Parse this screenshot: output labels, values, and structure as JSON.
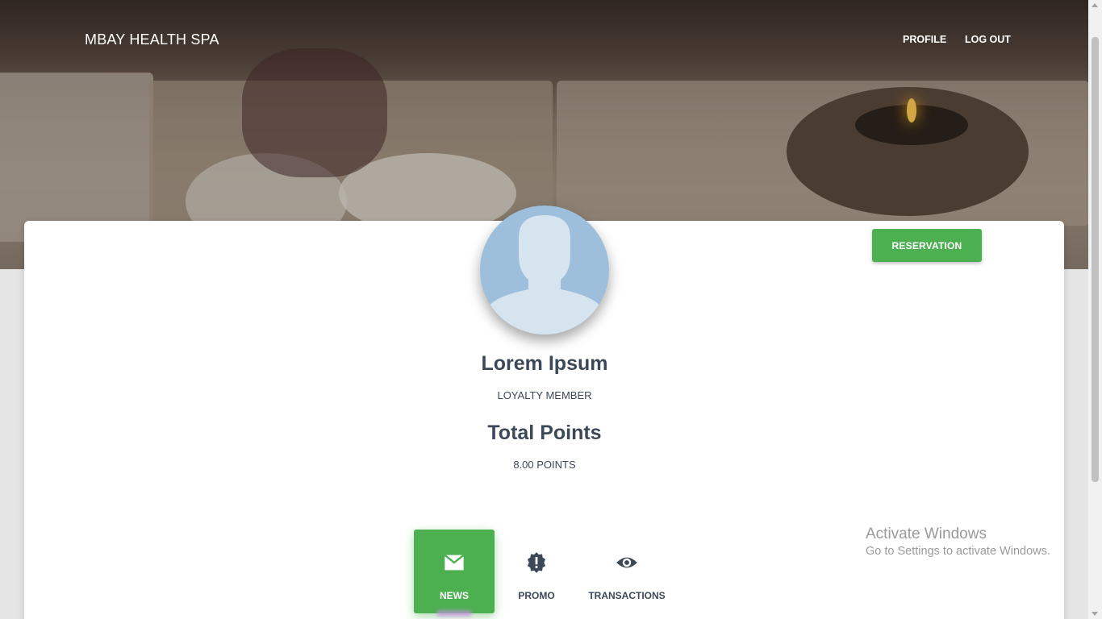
{
  "navbar": {
    "brand": "MBAY HEALTH SPA",
    "links": [
      {
        "label": "PROFILE"
      },
      {
        "label": "LOG OUT"
      }
    ]
  },
  "profile": {
    "name": "Lorem Ipsum",
    "role": "LOYALTY MEMBER",
    "points_title": "Total Points",
    "points_value": "8.00 POINTS",
    "reservation_label": "RESERVATION"
  },
  "tabs": [
    {
      "label": "NEWS",
      "icon": "envelope-icon",
      "active": true
    },
    {
      "label": "PROMO",
      "icon": "exclamation-badge-icon",
      "active": false
    },
    {
      "label": "TRANSACTIONS",
      "icon": "eye-icon",
      "active": false
    }
  ],
  "watermark": {
    "line1": "Activate Windows",
    "line2": "Go to Settings to activate Windows."
  },
  "colors": {
    "accent_green": "#4caf50",
    "text_dark": "#3c4858",
    "avatar_bg": "#9dbfdc"
  }
}
